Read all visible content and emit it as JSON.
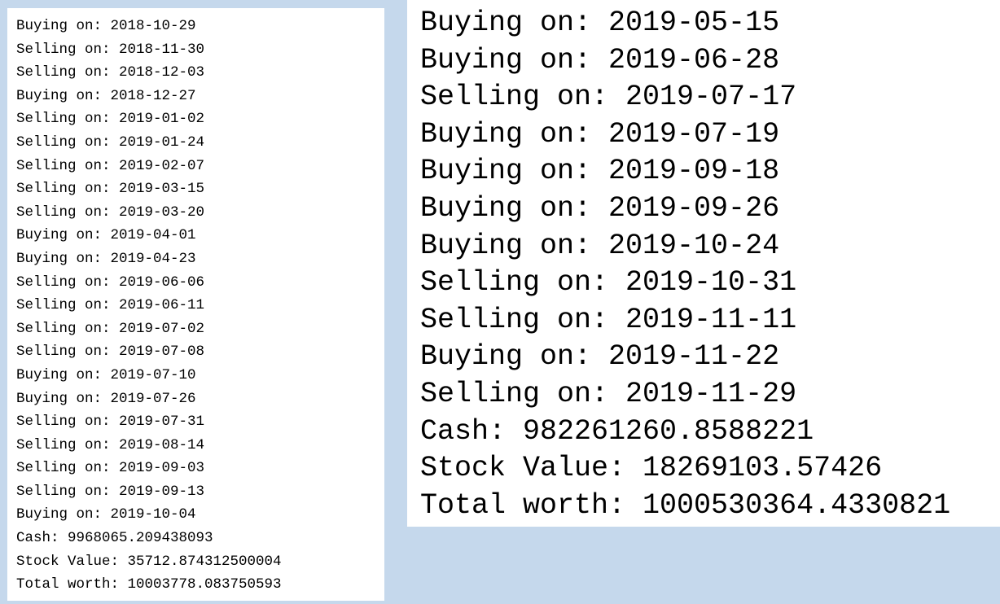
{
  "left_output": {
    "lines": [
      "Buying on: 2018-10-29",
      "Selling on: 2018-11-30",
      "Selling on: 2018-12-03",
      "Buying on: 2018-12-27",
      "Selling on: 2019-01-02",
      "Selling on: 2019-01-24",
      "Selling on: 2019-02-07",
      "Selling on: 2019-03-15",
      "Selling on: 2019-03-20",
      "Buying on: 2019-04-01",
      "Buying on: 2019-04-23",
      "Selling on: 2019-06-06",
      "Selling on: 2019-06-11",
      "Selling on: 2019-07-02",
      "Selling on: 2019-07-08",
      "Buying on: 2019-07-10",
      "Buying on: 2019-07-26",
      "Selling on: 2019-07-31",
      "Selling on: 2019-08-14",
      "Selling on: 2019-09-03",
      "Selling on: 2019-09-13",
      "Buying on: 2019-10-04",
      "Cash: 9968065.209438093",
      "Stock Value: 35712.874312500004",
      "Total worth: 10003778.083750593"
    ]
  },
  "right_output": {
    "lines": [
      "Buying on: 2019-05-15",
      "Buying on: 2019-06-28",
      "Selling on: 2019-07-17",
      "Buying on: 2019-07-19",
      "Buying on: 2019-09-18",
      "Buying on: 2019-09-26",
      "Buying on: 2019-10-24",
      "Selling on: 2019-10-31",
      "Selling on: 2019-11-11",
      "Buying on: 2019-11-22",
      "Selling on: 2019-11-29",
      "Cash: 982261260.8588221",
      "Stock Value: 18269103.57426",
      "Total worth: 1000530364.4330821"
    ]
  }
}
